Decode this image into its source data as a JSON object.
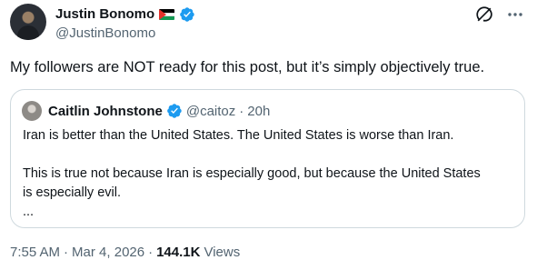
{
  "author": {
    "name": "Justin Bonomo",
    "handle": "@JustinBonomo"
  },
  "tweet": {
    "text": "My followers are NOT ready for this post, but it’s simply objectively true."
  },
  "quoted": {
    "name": "Caitlin Johnstone",
    "handle": "@caitoz",
    "separator": "·",
    "time": "20h",
    "lines": [
      "Iran is better than the United States. The United States is worse than Iran.",
      "This is true not because Iran is especially good, but because the United States",
      "is especially evil.",
      "..."
    ]
  },
  "meta": {
    "time": "7:55 AM",
    "separator": "·",
    "date": "Mar 4, 2026",
    "separator2": "·",
    "views_count": "144.1K",
    "views_label": "Views"
  },
  "colors": {
    "verified": "#1d9bf0",
    "secondary_text": "#536471",
    "border": "#cfd9de"
  },
  "icons": {
    "grok": "grok-icon",
    "more": "more-icon",
    "verified": "verified-badge-icon",
    "flag": "palestine-flag-icon"
  }
}
